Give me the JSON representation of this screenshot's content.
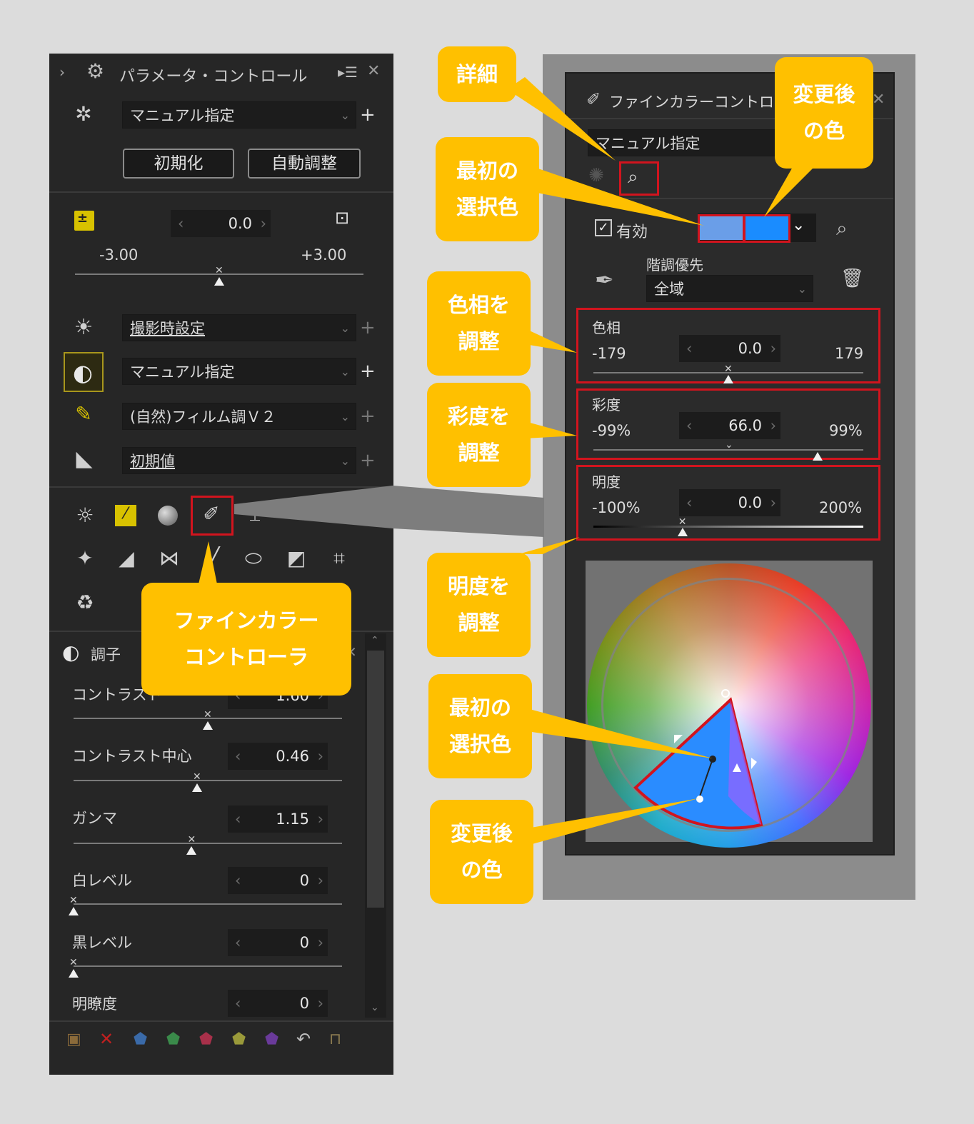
{
  "left_panel": {
    "title": "パラメータ・コントロール",
    "preset": "マニュアル指定",
    "reset_button": "初期化",
    "auto_button": "自動調整",
    "exposure": {
      "value": "0.0",
      "min": "-3.00",
      "max": "+3.00",
      "level": 0.5
    },
    "rows": [
      {
        "label": "撮影時設定",
        "plus": "+"
      },
      {
        "label": "マニュアル指定",
        "plus": "+"
      },
      {
        "label": "(自然)フィルム調Ｖ２",
        "plus": "+"
      },
      {
        "label": "初期値",
        "plus": "+"
      }
    ],
    "tone_panel_title": "調子",
    "tone_sliders": [
      {
        "label": "コントラスト",
        "value": "1.60",
        "level": 0.5
      },
      {
        "label": "コントラスト中心",
        "value": "0.46",
        "level": 0.46
      },
      {
        "label": "ガンマ",
        "value": "1.15",
        "level": 0.44
      },
      {
        "label": "白レベル",
        "value": "0",
        "level": 0.0
      },
      {
        "label": "黒レベル",
        "value": "0",
        "level": 0.0
      },
      {
        "label": "明瞭度",
        "value": "0"
      }
    ]
  },
  "right_panel": {
    "title": "ファインカラーコントローラ",
    "preset": "マニュアル指定",
    "enabled_label": "有効",
    "colors": {
      "initial": "#6a9ee8",
      "changed": "#1a8cff",
      "highlight": "#d2141e",
      "callout": "#ffc000"
    },
    "gradation_label": "階調優先",
    "range": "全域",
    "hue": {
      "label": "色相",
      "min": "-179",
      "value": "0.0",
      "max": "179",
      "level": 0.5
    },
    "saturation": {
      "label": "彩度",
      "min": "-99%",
      "value": "66.0",
      "max": "99%",
      "level": 0.83
    },
    "brightness": {
      "label": "明度",
      "min": "-100%",
      "value": "0.0",
      "max": "200%",
      "level": 0.33
    }
  },
  "callouts": {
    "detail": "詳細",
    "changed_color_top": "変更後\nの色",
    "initial_color_top": "最初の\n選択色",
    "adjust_hue": "色相を\n調整",
    "adjust_saturation": "彩度を\n調整",
    "adjust_brightness": "明度を\n調整",
    "initial_color_wheel": "最初の\n選択色",
    "changed_color_wheel": "変更後\nの色",
    "fine_color_controller": "ファインカラー\nコントローラ"
  },
  "icons": [
    "settings-gear-icon",
    "exposure-icon",
    "sun-icon",
    "contrast-icon",
    "picture-control-icon",
    "tone-curve-icon",
    "fine-color-icon",
    "trash-icon",
    "eyedropper-icon",
    "crop-icon",
    "undo-icon",
    "lock-icon",
    "close-icon",
    "menu-icon"
  ]
}
